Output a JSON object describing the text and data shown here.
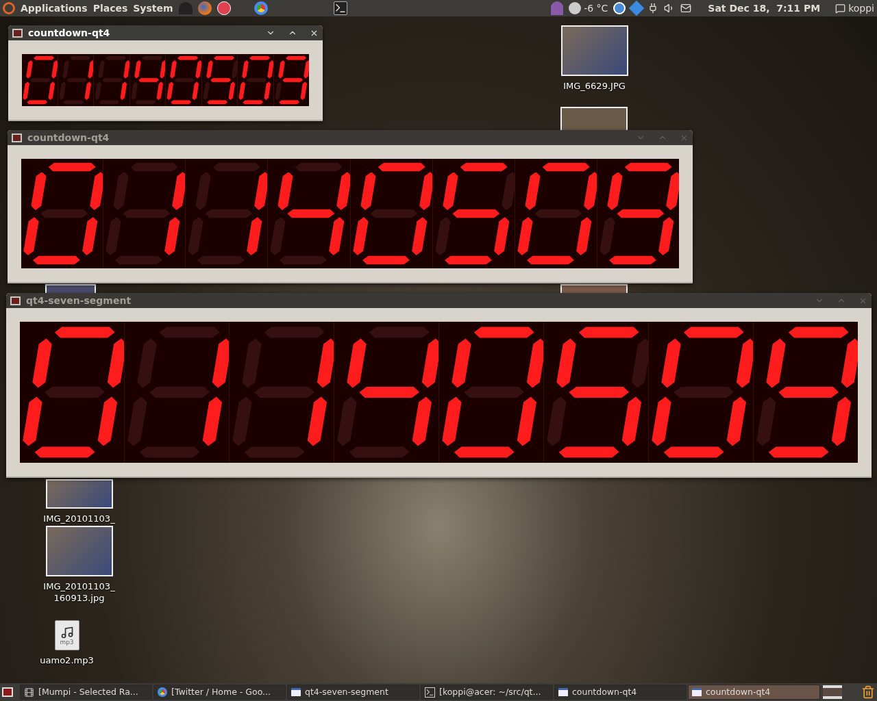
{
  "top_panel": {
    "menus": [
      "Applications",
      "Places",
      "System"
    ],
    "weather": "-6 °C",
    "clock": "Sat Dec 18,  7:11 PM",
    "user": "koppi"
  },
  "desktop_icons": [
    {
      "kind": "photo",
      "label": "IMG_6629.JPG"
    },
    {
      "kind": "photo",
      "label": "IMG_20101103_"
    },
    {
      "kind": "photo",
      "label": "IMG_20101103_ 160913.jpg"
    },
    {
      "kind": "audio",
      "label": "uamo2.mp3",
      "badge": "mp3"
    }
  ],
  "windows": [
    {
      "title": "countdown-qt4",
      "active": true,
      "digits": [
        {
          "lit": [
            true,
            true,
            true,
            true,
            true,
            true,
            false
          ]
        },
        {
          "lit": [
            false,
            true,
            true,
            false,
            false,
            false,
            false
          ]
        },
        {
          "lit": [
            false,
            true,
            true,
            false,
            false,
            false,
            false
          ]
        },
        {
          "lit": [
            false,
            true,
            true,
            false,
            false,
            true,
            true
          ]
        },
        {
          "lit": [
            true,
            true,
            true,
            true,
            true,
            true,
            false
          ]
        },
        {
          "lit": [
            true,
            false,
            true,
            true,
            false,
            true,
            true
          ]
        },
        {
          "lit": [
            true,
            true,
            true,
            true,
            true,
            true,
            false
          ]
        },
        {
          "lit": [
            true,
            true,
            true,
            true,
            false,
            true,
            true
          ]
        }
      ]
    },
    {
      "title": "countdown-qt4",
      "active": false,
      "digits": [
        {
          "lit": [
            true,
            true,
            true,
            true,
            true,
            true,
            false
          ]
        },
        {
          "lit": [
            false,
            true,
            true,
            false,
            false,
            false,
            false
          ]
        },
        {
          "lit": [
            false,
            true,
            true,
            false,
            false,
            false,
            false
          ]
        },
        {
          "lit": [
            false,
            true,
            true,
            false,
            false,
            true,
            true
          ]
        },
        {
          "lit": [
            true,
            true,
            true,
            true,
            true,
            true,
            false
          ]
        },
        {
          "lit": [
            true,
            false,
            true,
            true,
            false,
            true,
            true
          ]
        },
        {
          "lit": [
            true,
            true,
            true,
            true,
            true,
            true,
            false
          ]
        },
        {
          "lit": [
            true,
            true,
            true,
            true,
            false,
            true,
            true
          ]
        }
      ]
    },
    {
      "title": "qt4-seven-segment",
      "active": false,
      "digits": [
        {
          "lit": [
            true,
            true,
            true,
            true,
            true,
            true,
            false
          ]
        },
        {
          "lit": [
            false,
            true,
            true,
            false,
            false,
            false,
            false
          ]
        },
        {
          "lit": [
            false,
            true,
            true,
            false,
            false,
            false,
            false
          ]
        },
        {
          "lit": [
            false,
            true,
            true,
            false,
            false,
            true,
            true
          ]
        },
        {
          "lit": [
            true,
            true,
            true,
            true,
            true,
            true,
            false
          ]
        },
        {
          "lit": [
            true,
            false,
            true,
            true,
            false,
            true,
            true
          ]
        },
        {
          "lit": [
            true,
            true,
            true,
            true,
            true,
            true,
            false
          ]
        },
        {
          "lit": [
            true,
            true,
            true,
            true,
            false,
            true,
            true
          ]
        }
      ]
    }
  ],
  "taskbar": [
    {
      "kind": "media",
      "label": "[Mumpi - Selected Ra...",
      "selected": false
    },
    {
      "kind": "browser",
      "label": "[Twitter / Home - Goo...",
      "selected": false
    },
    {
      "kind": "window",
      "label": "qt4-seven-segment",
      "selected": false
    },
    {
      "kind": "terminal",
      "label": "[koppi@acer: ~/src/qt...",
      "selected": false
    },
    {
      "kind": "window",
      "label": "countdown-qt4",
      "selected": false
    },
    {
      "kind": "window",
      "label": "countdown-qt4",
      "selected": true
    }
  ]
}
